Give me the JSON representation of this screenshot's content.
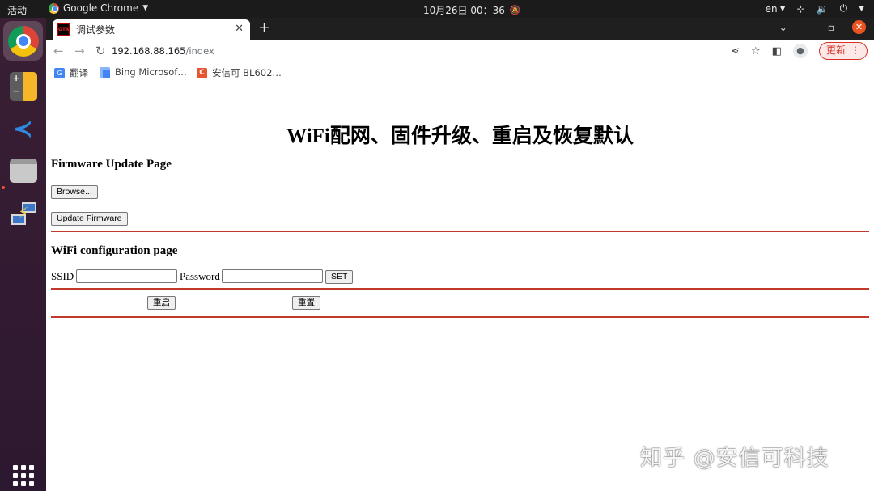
{
  "topbar": {
    "activities": "活动",
    "app_name": "Google Chrome",
    "clock": "10月26日  00：36",
    "lang": "en"
  },
  "tabs": [
    {
      "title": "调试参数",
      "favicon_text": "GTA"
    }
  ],
  "toolbar": {
    "url_host": "192.168.88.165",
    "url_path": "/index",
    "update_label": "更新"
  },
  "bookmarks": [
    {
      "label": "翻译",
      "icon": "translate-icon"
    },
    {
      "label": "Bing Microsof…",
      "icon": "bing-icon"
    },
    {
      "label": "安信可 BL602…",
      "icon": "ai-thinker-icon"
    }
  ],
  "page": {
    "title": "WiFi配网、固件升级、重启及恢复默认",
    "firmware_heading": "Firmware Update Page",
    "browse_label": "Browse...",
    "update_firmware_label": "Update Firmware",
    "wifi_heading": "WiFi configuration page",
    "ssid_label": "SSID",
    "ssid_value": "",
    "password_label": "Password",
    "password_value": "",
    "set_label": "SET",
    "restart_label": "重启",
    "reset_label": "重置",
    "accent_color": "#c0392b"
  },
  "watermark": "知乎 @安信可科技"
}
